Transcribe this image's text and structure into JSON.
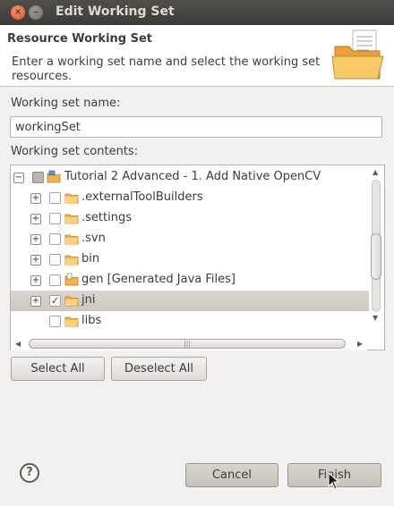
{
  "window": {
    "title": "Edit Working Set"
  },
  "header": {
    "title": "Resource Working Set",
    "description": "Enter a working set name and select the working set resources."
  },
  "name": {
    "label": "Working set name:",
    "value": "workingSet"
  },
  "contents": {
    "label": "Working set contents:",
    "items": [
      {
        "label": "Tutorial 2 Advanced - 1. Add Native OpenCV",
        "expander": "−",
        "check": "",
        "icon": "project-folder-icon"
      },
      {
        "label": ".externalToolBuilders",
        "expander": "+",
        "check": "",
        "icon": "folder-icon"
      },
      {
        "label": ".settings",
        "expander": "+",
        "check": "",
        "icon": "folder-icon"
      },
      {
        "label": ".svn",
        "expander": "+",
        "check": "",
        "icon": "folder-icon"
      },
      {
        "label": "bin",
        "expander": "+",
        "check": "",
        "icon": "folder-icon"
      },
      {
        "label": "gen [Generated Java Files]",
        "expander": "+",
        "check": "",
        "icon": "source-folder-icon"
      },
      {
        "label": "jni",
        "expander": "+",
        "check": "✓",
        "icon": "folder-icon"
      },
      {
        "label": "libs",
        "expander": "",
        "check": "",
        "icon": "folder-icon"
      }
    ]
  },
  "buttons": {
    "select_all": "Select All",
    "deselect_all": "Deselect All",
    "help": "?",
    "cancel": "Cancel",
    "finish": "Finish"
  },
  "window_buttons": {
    "close": "×",
    "minimize": "–"
  },
  "scroll": {
    "h_grip": "|||"
  },
  "colors": {
    "titlebar": "#3c3b37",
    "selection": "#cdc8bf",
    "folder": "#f3b54a",
    "close": "#e05a2b"
  }
}
